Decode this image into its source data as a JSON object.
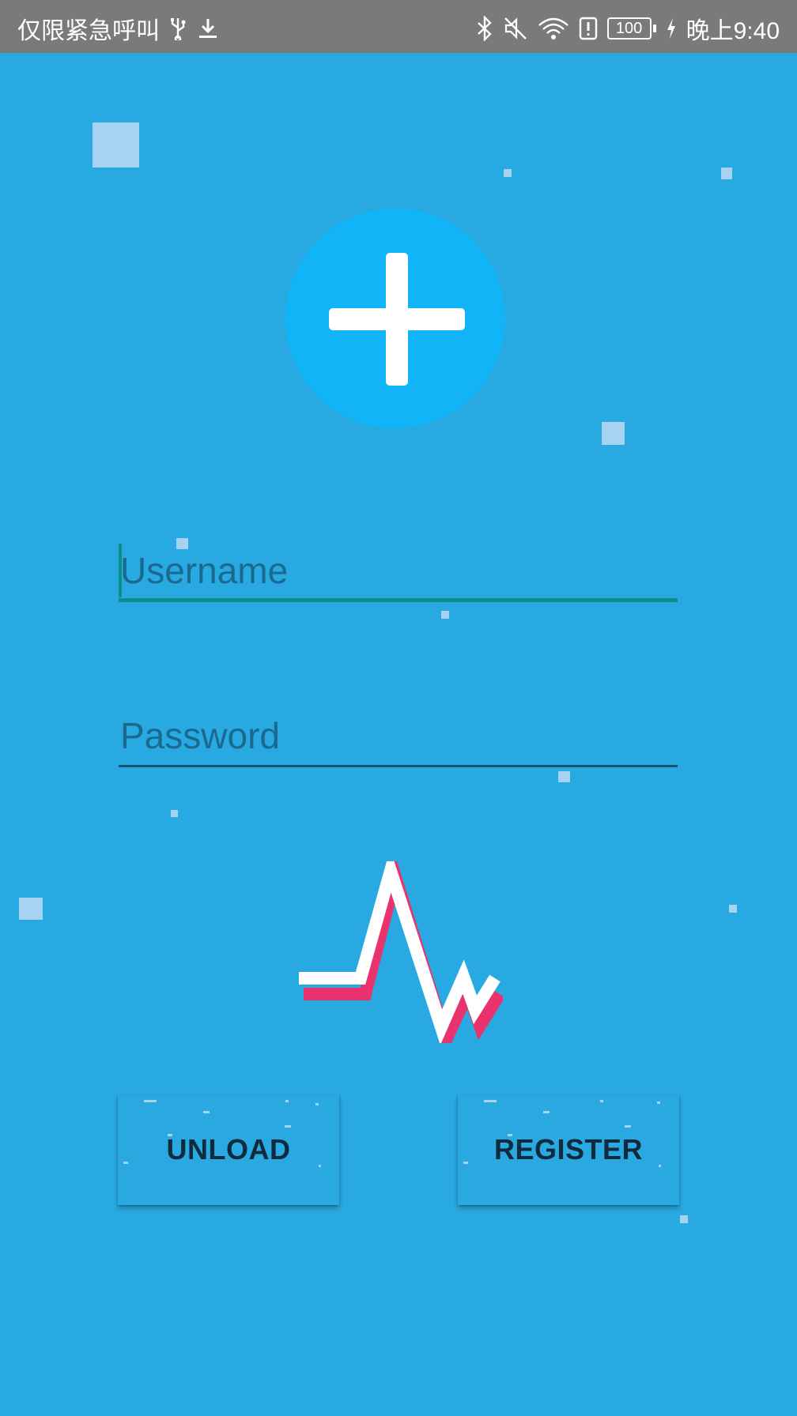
{
  "status_bar": {
    "carrier_text": "仅限紧急呼叫",
    "battery_level": "100",
    "time": "晚上9:40",
    "icons": [
      "usb-icon",
      "download-icon",
      "bluetooth-icon",
      "mute-icon",
      "wifi-icon",
      "alert-icon",
      "battery-icon",
      "charging-icon"
    ]
  },
  "logo": {
    "icon": "medical-cross-icon",
    "circle_color": "#10b4f7"
  },
  "form": {
    "username_placeholder": "Username",
    "username_value": "",
    "password_placeholder": "Password",
    "password_value": ""
  },
  "heartbeat": {
    "icon": "heartbeat-icon",
    "line_color": "#ffffff",
    "shadow_color": "#e8336d"
  },
  "buttons": {
    "unload_label": "UNLOAD",
    "register_label": "REGISTER"
  },
  "colors": {
    "background": "#29a9e1",
    "status_bar": "#7a7a7a",
    "accent": "#0c8f8c"
  }
}
